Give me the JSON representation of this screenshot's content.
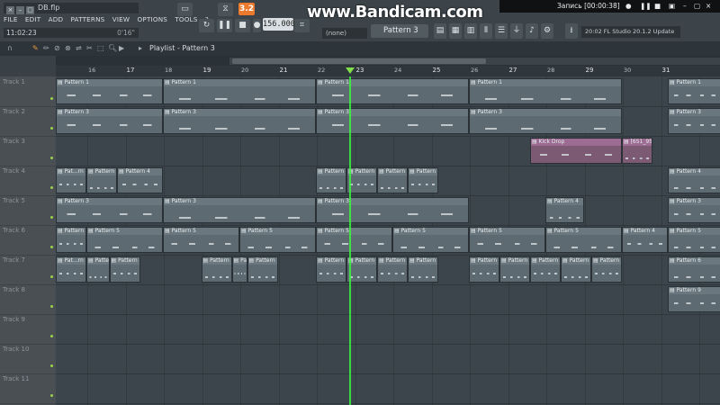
{
  "file": {
    "name": "DB.flp"
  },
  "menu": [
    "FILE",
    "EDIT",
    "ADD",
    "PATTERNS",
    "VIEW",
    "OPTIONS",
    "TOOLS",
    "?"
  ],
  "time": {
    "display": "11:02:23",
    "hint": "0'16\""
  },
  "transport": {
    "pattern_number": "3.2",
    "tempo": "156.000"
  },
  "watermark": "www.Bandicam.com",
  "recording": {
    "label": "Запись [00:00:38]"
  },
  "selector": {
    "none_label": "(none)",
    "pattern_label": "Pattern 3"
  },
  "update": {
    "text": "20:02  FL Studio 20.1.2 Update"
  },
  "playlist": {
    "title": "Playlist - Pattern 3"
  },
  "ruler": [
    "16",
    "17",
    "18",
    "19",
    "20",
    "21",
    "22",
    "23",
    "24",
    "25",
    "26",
    "27",
    "28",
    "29",
    "30",
    "31"
  ],
  "tracks": [
    {
      "name": "Track 1",
      "clips": [
        {
          "label": "Pattern 1",
          "start": 0,
          "length": 14
        },
        {
          "label": "Pattern 1",
          "start": 14,
          "length": 20
        },
        {
          "label": "Pattern 1",
          "start": 34,
          "length": 20
        },
        {
          "label": "Pattern 1",
          "start": 54,
          "length": 20
        },
        {
          "label": "Pattern 1",
          "start": 80,
          "length": 7
        }
      ]
    },
    {
      "name": "Track 2",
      "clips": [
        {
          "label": "Pattern 3",
          "start": 0,
          "length": 14
        },
        {
          "label": "Pattern 3",
          "start": 14,
          "length": 20
        },
        {
          "label": "Pattern 3",
          "start": 34,
          "length": 20
        },
        {
          "label": "Pattern 3",
          "start": 54,
          "length": 20
        },
        {
          "label": "Pattern 3",
          "start": 80,
          "length": 7
        }
      ]
    },
    {
      "name": "Track 3",
      "clips": [
        {
          "label": "Kick Drop",
          "start": 62,
          "length": 12,
          "audio": true
        },
        {
          "label": "[651_951]",
          "start": 74,
          "length": 4,
          "audio": true
        }
      ]
    },
    {
      "name": "Track 4",
      "clips": [
        {
          "label": "Pat...rn 4",
          "start": 0,
          "length": 4
        },
        {
          "label": "Pattern 4",
          "start": 4,
          "length": 4
        },
        {
          "label": "Pattern 4",
          "start": 8,
          "length": 6
        },
        {
          "label": "Pattern 4",
          "start": 34,
          "length": 4
        },
        {
          "label": "Pattern 4",
          "start": 38,
          "length": 4
        },
        {
          "label": "Pattern 4",
          "start": 42,
          "length": 4
        },
        {
          "label": "Pattern 4",
          "start": 46,
          "length": 4
        },
        {
          "label": "Pattern 4",
          "start": 80,
          "length": 7
        }
      ]
    },
    {
      "name": "Track 5",
      "clips": [
        {
          "label": "Pattern 3",
          "start": 0,
          "length": 14
        },
        {
          "label": "Pattern 3",
          "start": 14,
          "length": 20
        },
        {
          "label": "Pattern 3",
          "start": 34,
          "length": 20
        },
        {
          "label": "Pattern 4",
          "start": 64,
          "length": 5
        },
        {
          "label": "Pattern 3",
          "start": 80,
          "length": 7
        }
      ]
    },
    {
      "name": "Track 6",
      "clips": [
        {
          "label": "Pattern 5",
          "start": 0,
          "length": 4
        },
        {
          "label": "Pattern 5",
          "start": 4,
          "length": 10
        },
        {
          "label": "Pattern 5",
          "start": 14,
          "length": 10
        },
        {
          "label": "Pattern 5",
          "start": 24,
          "length": 10
        },
        {
          "label": "Pattern 5",
          "start": 34,
          "length": 10
        },
        {
          "label": "Pattern 5",
          "start": 44,
          "length": 10
        },
        {
          "label": "Pattern 5",
          "start": 54,
          "length": 10
        },
        {
          "label": "Pattern 5",
          "start": 64,
          "length": 10
        },
        {
          "label": "Pattern 4",
          "start": 74,
          "length": 6
        },
        {
          "label": "Pattern 5",
          "start": 80,
          "length": 7
        }
      ]
    },
    {
      "name": "Track 7",
      "clips": [
        {
          "label": "Pat...rn 6",
          "start": 0,
          "length": 4
        },
        {
          "label": "Patte",
          "start": 4,
          "length": 3
        },
        {
          "label": "Pattern 6",
          "start": 7,
          "length": 4
        },
        {
          "label": "Pattern 6",
          "start": 19,
          "length": 4
        },
        {
          "label": "Patte",
          "start": 23,
          "length": 2
        },
        {
          "label": "Pattern 6",
          "start": 25,
          "length": 4
        },
        {
          "label": "Pattern 6",
          "start": 34,
          "length": 4
        },
        {
          "label": "Pattern 6",
          "start": 38,
          "length": 4
        },
        {
          "label": "Pattern 6",
          "start": 42,
          "length": 4
        },
        {
          "label": "Pattern 6",
          "start": 46,
          "length": 4
        },
        {
          "label": "Pattern 6",
          "start": 54,
          "length": 4
        },
        {
          "label": "Pattern 6",
          "start": 58,
          "length": 4
        },
        {
          "label": "Pattern 6",
          "start": 62,
          "length": 4
        },
        {
          "label": "Pattern 6",
          "start": 66,
          "length": 4
        },
        {
          "label": "Pattern 6",
          "start": 70,
          "length": 4
        },
        {
          "label": "Pattern 6",
          "start": 80,
          "length": 7
        }
      ]
    },
    {
      "name": "Track 8",
      "clips": [
        {
          "label": "Pattern 9",
          "start": 80,
          "length": 7
        }
      ]
    },
    {
      "name": "Track 9",
      "clips": []
    },
    {
      "name": "Track 10",
      "clips": []
    },
    {
      "name": "Track 11",
      "clips": []
    }
  ]
}
